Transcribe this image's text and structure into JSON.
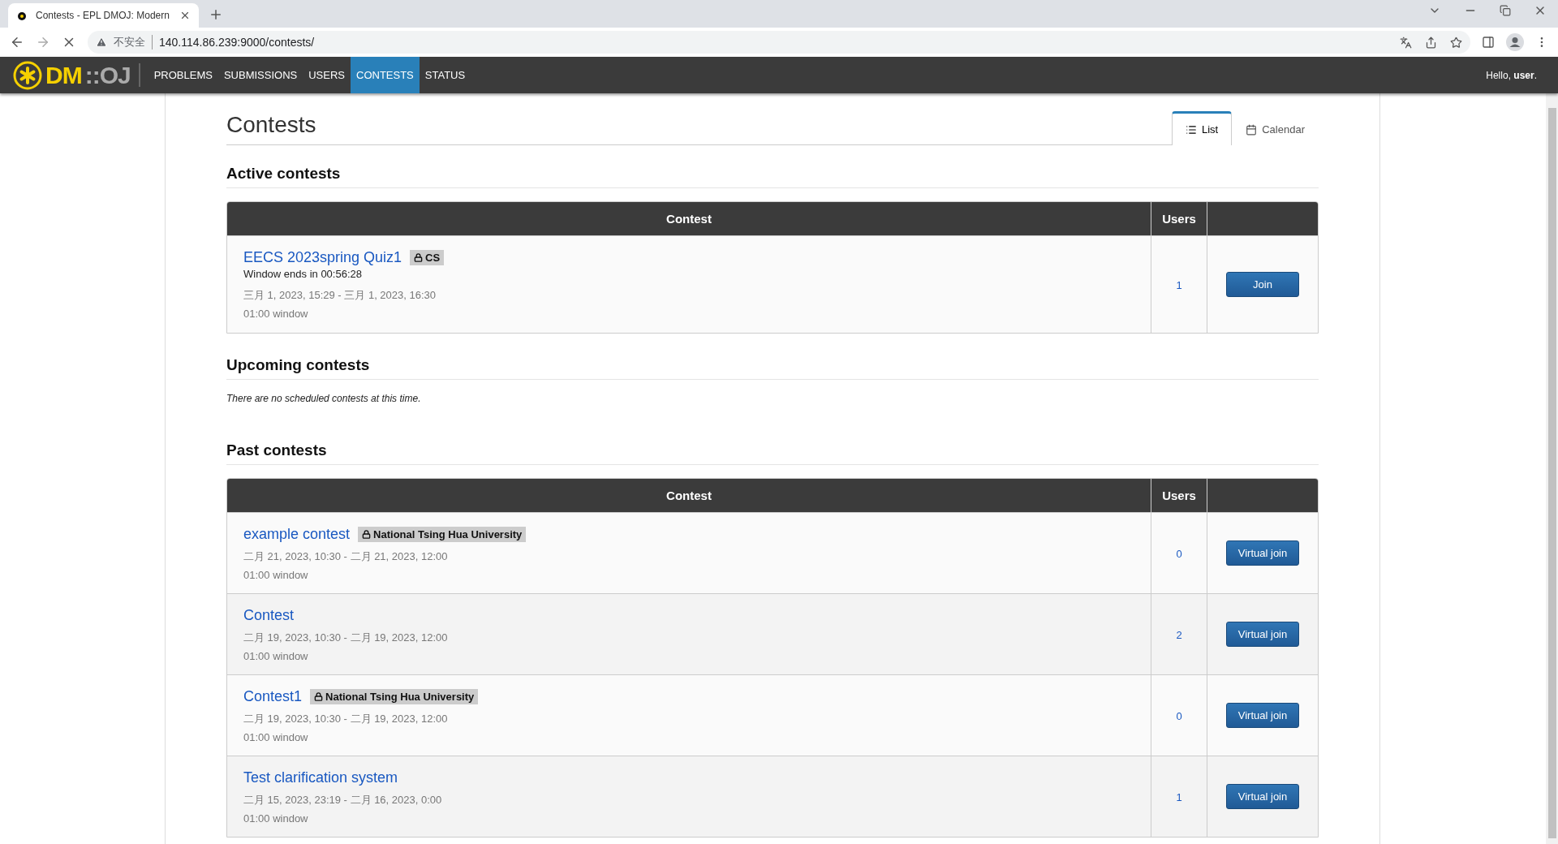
{
  "browser": {
    "tab_title": "Contests - EPL DMOJ: Modern",
    "security_label": "不安全",
    "url": "140.114.86.239:9000/contests/"
  },
  "nav": {
    "logo": {
      "main": "DM",
      "accent": "::OJ"
    },
    "items": [
      {
        "label": "PROBLEMS",
        "selected": false
      },
      {
        "label": "SUBMISSIONS",
        "selected": false
      },
      {
        "label": "USERS",
        "selected": false
      },
      {
        "label": "CONTESTS",
        "selected": true
      },
      {
        "label": "STATUS",
        "selected": false
      }
    ],
    "greeting": "Hello, **user**."
  },
  "page": {
    "title": "Contests",
    "view_tabs": [
      {
        "label": "List",
        "kind": "list",
        "selected": true
      },
      {
        "label": "Calendar",
        "kind": "calendar",
        "selected": false
      }
    ]
  },
  "sections": [
    {
      "title": "Active contests",
      "kind": "table",
      "columns": [
        "Contest",
        "Users"
      ],
      "rows": [
        {
          "name": "EECS 2023spring Quiz1",
          "tag": "CS",
          "countdown": "Window ends in 00:56:28",
          "time": "三月 1, 2023, 15:29 - 三月 1, 2023, 16:30",
          "window": "01:00 window",
          "users": "1",
          "action": "Join"
        }
      ]
    },
    {
      "title": "Upcoming contests",
      "kind": "empty",
      "message": "There are no scheduled contests at this time."
    },
    {
      "title": "Past contests",
      "kind": "table",
      "columns": [
        "Contest",
        "Users"
      ],
      "rows": [
        {
          "name": "example contest",
          "tag": "National Tsing Hua University",
          "time": "二月 21, 2023, 10:30 - 二月 21, 2023, 12:00",
          "window": "01:00 window",
          "users": "0",
          "action": "Virtual join"
        },
        {
          "name": "Contest",
          "time": "二月 19, 2023, 10:30 - 二月 19, 2023, 12:00",
          "window": "01:00 window",
          "users": "2",
          "action": "Virtual join"
        },
        {
          "name": "Contest1",
          "tag": "National Tsing Hua University",
          "time": "二月 19, 2023, 10:30 - 二月 19, 2023, 12:00",
          "window": "01:00 window",
          "users": "0",
          "action": "Virtual join"
        },
        {
          "name": "Test clarification system",
          "time": "二月 15, 2023, 23:19 - 二月 16, 2023, 0:00",
          "window": "01:00 window",
          "users": "1",
          "action": "Virtual join"
        }
      ]
    }
  ]
}
